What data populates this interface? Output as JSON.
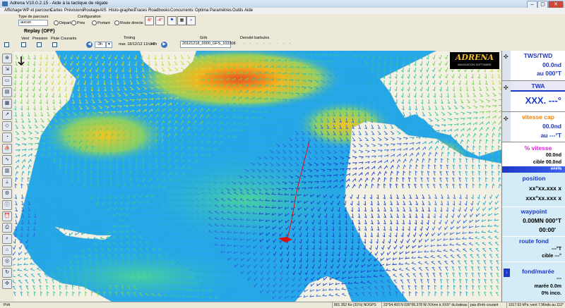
{
  "window": {
    "title": "Adrena V10.0.2.15 - Aide à la tactique de régate",
    "minimize": "‒",
    "maximize": "▢",
    "close": "✕"
  },
  "menu": [
    "Affichage",
    "WP et parcours",
    "Cartes",
    "Prévisions",
    "Routage",
    "AIS",
    "Histo-graphes",
    "Traces",
    "Roadbooks",
    "Concurrents",
    "Optima",
    "Paramètres",
    "Outils",
    "Aide"
  ],
  "toolbar": {
    "type_parcours_label": "Type de parcours",
    "type_parcours_value": "aucun",
    "configuration_label": "Configuration",
    "config_options": [
      "Départ",
      "Près",
      "Portant",
      "Route directe"
    ],
    "replay_label": "Replay (OFF)",
    "layers": [
      "Vent",
      "Pression",
      "Pluie",
      "Courants"
    ],
    "timing_label": "Timing",
    "grib_label": "Grib",
    "densite_label": "Densité barbules",
    "step_value": "-3h",
    "date_value": "mar. 18/12/12 11h34",
    "step_forward": "+3h",
    "grib_file": "20121218_0000_GFS_103308",
    "temp_neg": "-6°",
    "temp_neg2": "-4°"
  },
  "logo": {
    "text": "ADRENA",
    "sub": "NAVIGATION SOFTWARE"
  },
  "panel": {
    "tws_title": "TWS/TWD",
    "tws_value": "00.0nd",
    "tws_dir": "au 000°T",
    "twa_title": "TWA",
    "twa_value": "XXX. ---°",
    "vcap_title": "vitesse cap",
    "vcap_value": "00.0nd",
    "vcap_dir": "au ---°T",
    "pct_title": "% vitesse",
    "pct_value": "00.0nd",
    "pct_target": "cible 00.0nd",
    "pct_bar": "###%",
    "pos_title": "position",
    "pos_lat": "xx°xx.xxx x",
    "pos_lon": "xxx°xx.xxx x",
    "wp_title": "waypoint",
    "wp_value": "0.00MN 000°T",
    "wp_time": "00:00'",
    "rf_title": "route fond",
    "rf_value": "---°T",
    "rf_target": "cible ---°",
    "fm_title": "fond/marée",
    "fm_value": "---",
    "fm_maree": "marée 0.0m",
    "fm_inco": "0% inco."
  },
  "status": {
    "ready": "Prêt",
    "memory": "801 352 Ko (31%) NOGPS",
    "coords": "23°54.493 N 030°06.378 W /XXmn à XXX° du bateau",
    "info": "pas d'info courant",
    "pressure": "1017.63 hPa ;vent 7.96nds au 112°"
  },
  "colors": {
    "sea": "#26a7e9",
    "land": "#f3f0e4",
    "accent": "#1c38c8",
    "panel_title": "#1c38c8",
    "orange": "#f08000",
    "pink": "#e020e0",
    "route": "#e01010"
  }
}
